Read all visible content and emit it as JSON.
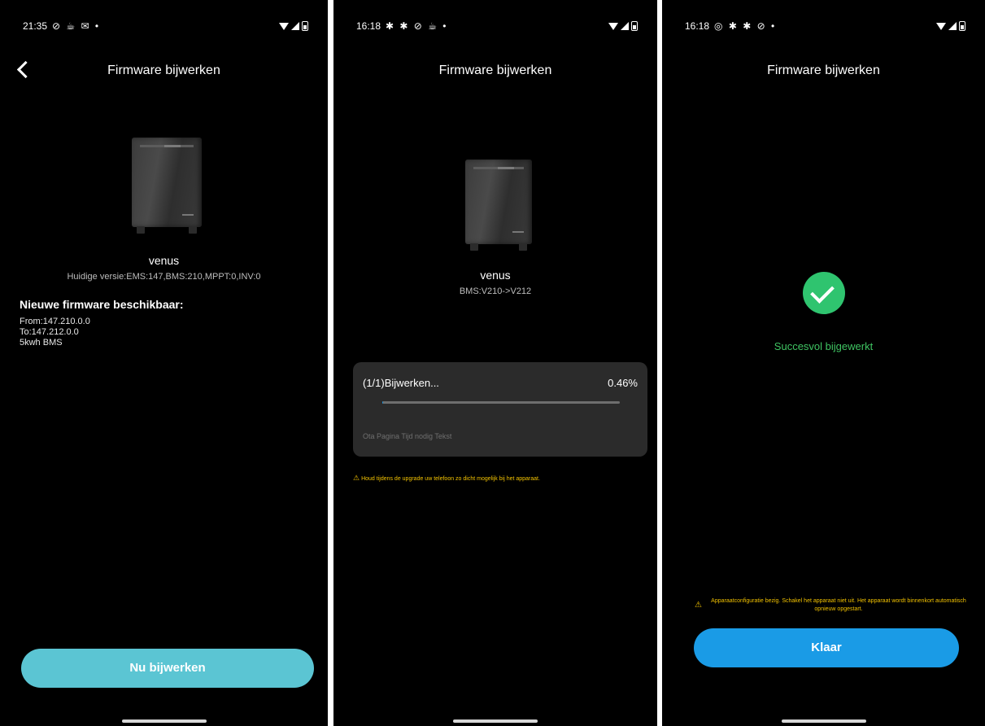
{
  "screen1": {
    "status": {
      "time": "21:35",
      "icons": "⊘ ☕ ✉ •"
    },
    "header": {
      "title": "Firmware bijwerken"
    },
    "device": {
      "name": "venus",
      "current_version": "Huidige versie:EMS:147,BMS:210,MPPT:0,INV:0"
    },
    "new_firmware": {
      "heading": "Nieuwe firmware beschikbaar:",
      "from": "From:147.210.0.0",
      "to": "To:147.212.0.0",
      "model": "5kwh BMS"
    },
    "button": {
      "label": "Nu bijwerken"
    }
  },
  "screen2": {
    "status": {
      "time": "16:18",
      "icons": "✱ ✱ ⊘ ☕ •"
    },
    "header": {
      "title": "Firmware bijwerken"
    },
    "device": {
      "name": "venus",
      "version_change": "BMS:V210->V212"
    },
    "progress": {
      "label": "(1/1)Bijwerken...",
      "percent_text": "0.46%",
      "percent": 0.46,
      "ota_text": "Ota Pagina Tijd nodig Tekst"
    },
    "warning": "Houd tijdens de upgrade uw telefoon zo dicht mogelijk bij het apparaat."
  },
  "screen3": {
    "status": {
      "time": "16:18",
      "icons": "◎ ✱ ✱ ⊘ •"
    },
    "header": {
      "title": "Firmware bijwerken"
    },
    "success": {
      "text": "Succesvol bijgewerkt"
    },
    "config_warning": "Apparaatconfiguratie bezig. Schakel het apparaat niet uit. Het apparaat wordt binnenkort automatisch opnieuw opgestart.",
    "button": {
      "label": "Klaar"
    }
  },
  "colors": {
    "background": "#000000",
    "update_button": "#5bc5d3",
    "done_button": "#1a9be6",
    "success_green": "#2fc46f",
    "warning_yellow": "#f2c200",
    "progress_card": "#2b2b2b"
  },
  "icons": {
    "back": "back-arrow-icon",
    "success": "check-circle-icon",
    "warning": "warning-triangle-icon"
  }
}
